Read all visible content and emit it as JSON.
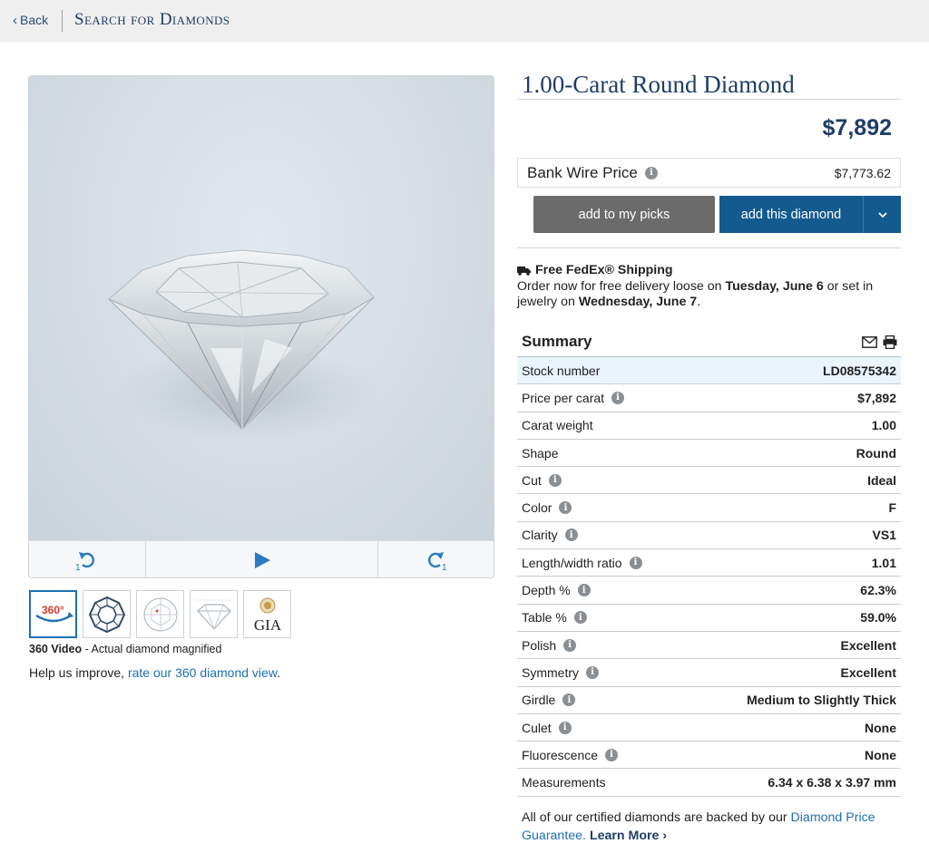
{
  "nav": {
    "back_label": "Back",
    "crumb": "Search for Diamonds"
  },
  "product": {
    "title": "1.00-Carat Round Diamond",
    "price": "$7,892",
    "bank_wire_label": "Bank Wire Price",
    "bank_wire_price": "$7,773.62"
  },
  "actions": {
    "picks_label": "add to my picks",
    "add_label": "add this diamond"
  },
  "viewer": {
    "rotate_left_num": "1",
    "rotate_right_num": "1"
  },
  "thumbs": {
    "t360_label": "360°",
    "gia_label": "GIA"
  },
  "caption": {
    "bold": "360 Video",
    "rest": " - Actual diamond magnified"
  },
  "improve": {
    "text": "Help us improve, ",
    "link": "rate our 360 diamond view",
    "end": "."
  },
  "shipping": {
    "title": "Free FedEx® Shipping",
    "line1": "Order now for free delivery loose on ",
    "date1": "Tuesday, June 6",
    "line2": " or set in jewelry on ",
    "date2": "Wednesday, June 7",
    "end": "."
  },
  "summary": {
    "title": "Summary",
    "rows": [
      {
        "label": "Stock number",
        "value": "LD08575342"
      },
      {
        "label": "Price per carat",
        "value": "$7,892"
      },
      {
        "label": "Carat weight",
        "value": "1.00"
      },
      {
        "label": "Shape",
        "value": "Round"
      },
      {
        "label": "Cut",
        "value": "Ideal"
      },
      {
        "label": "Color",
        "value": "F"
      },
      {
        "label": "Clarity",
        "value": "VS1"
      },
      {
        "label": "Length/width ratio",
        "value": "1.01"
      },
      {
        "label": "Depth %",
        "value": "62.3%"
      },
      {
        "label": "Table %",
        "value": "59.0%"
      },
      {
        "label": "Polish",
        "value": "Excellent"
      },
      {
        "label": "Symmetry",
        "value": "Excellent"
      },
      {
        "label": "Girdle",
        "value": "Medium to Slightly Thick"
      },
      {
        "label": "Culet",
        "value": "None"
      },
      {
        "label": "Fluorescence",
        "value": "None"
      },
      {
        "label": "Measurements",
        "value": "6.34 x 6.38 x 3.97 mm"
      }
    ]
  },
  "guarantee": {
    "text": "All of our certified diamonds are backed by our ",
    "link": "Diamond Price Guarantee.",
    "learn": "Learn More"
  },
  "colors": {
    "navy": "#1f3d66",
    "link": "#1d6fb3",
    "button_blue": "#135a8f",
    "button_gray": "#6b6b6b"
  }
}
